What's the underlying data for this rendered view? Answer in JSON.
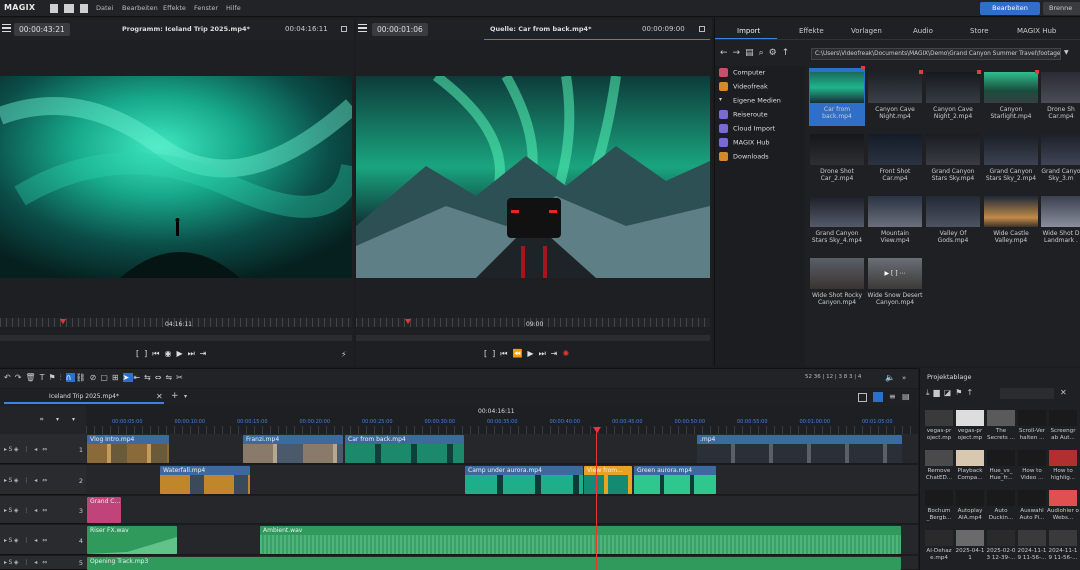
{
  "app": {
    "logo": "MAGIX",
    "menu": [
      "Datei",
      "Bearbeiten",
      "Effekte",
      "Fenster",
      "Hilfe"
    ],
    "mode_active": "Bearbeiten",
    "mode_other": "Brenne"
  },
  "program_monitor": {
    "timecode": "00:00:43:21",
    "title": "Programm: Iceland Trip 2025.mp4*",
    "duration": "00:04:16:11",
    "ruler_label": "04:16:11"
  },
  "source_monitor": {
    "timecode": "00:00:01:06",
    "title": "Quelle: Car from back.mp4*",
    "duration": "00:00:09:00",
    "ruler_label": "09:00"
  },
  "media_pool": {
    "tabs": [
      "Import",
      "Effekte",
      "Vorlagen",
      "Audio",
      "Store",
      "MAGIX Hub"
    ],
    "active_tab": "Import",
    "path": "C:\\Users\\Videofreak\\Documents\\MAGIX\\Demo\\Grand Canyon Summer Travel\\footage",
    "tree": [
      {
        "label": "Computer",
        "icon": "computer-icon",
        "color": "#c9506a"
      },
      {
        "label": "Videofreak",
        "icon": "user-icon",
        "color": "#d48a2c"
      },
      {
        "label": "Eigene Medien",
        "icon": "chevron-down-icon",
        "color": ""
      },
      {
        "label": "Reiseroute",
        "icon": "pin-icon",
        "color": "#7b6bd1"
      },
      {
        "label": "Cloud Import",
        "icon": "cloud-icon",
        "color": "#7b6bd1"
      },
      {
        "label": "MAGIX Hub",
        "icon": "hub-icon",
        "color": "#7b6bd1"
      },
      {
        "label": "Downloads",
        "icon": "download-icon",
        "color": "#d48a2c"
      }
    ],
    "files": [
      {
        "name": "Car from back.mp4",
        "selected": true
      },
      {
        "name": "Canyon Cave Night.mp4"
      },
      {
        "name": "Canyon Cave Night_2.mp4"
      },
      {
        "name": "Canyon Starlight.mp4"
      },
      {
        "name": "Drone Sh Car.mp4"
      },
      {
        "name": "Drone Shot Car_2.mp4"
      },
      {
        "name": "Front Shot Car.mp4"
      },
      {
        "name": "Grand Canyon Stars Sky.mp4"
      },
      {
        "name": "Grand Canyon Stars Sky_2.mp4"
      },
      {
        "name": "Grand Canyo Sky_3.m"
      },
      {
        "name": "Grand Canyon Stars Sky_4.mp4"
      },
      {
        "name": "Mountain View.mp4"
      },
      {
        "name": "Valley Of Gods.mp4"
      },
      {
        "name": "Wide Castle Valley.mp4"
      },
      {
        "name": "Wide Shot D Landmark ."
      },
      {
        "name": "Wide Shot Rocky Canyon.mp4"
      },
      {
        "name": "Wide Snow Desert Canyon.mp4"
      }
    ]
  },
  "timeline": {
    "tab": "Iceland Trip 2025.mp4*",
    "zoom_values": [
      "52",
      "36",
      "12",
      "3",
      "8",
      "3",
      "4"
    ],
    "current_time": "00:04:16:11",
    "ruler_ticks": [
      "00:00:05:00",
      "00:00:10:00",
      "00:00:15:00",
      "00:00:20:00",
      "00:00:25:00",
      "00:00:30:00",
      "00:00:35:00",
      "00:00:40:00",
      "00:00:45:00",
      "00:00:50:00",
      "00:00:55:00",
      "00:01:00:00",
      "00:01:05:00"
    ],
    "tracks": [
      {
        "num": "1"
      },
      {
        "num": "2"
      },
      {
        "num": "3"
      },
      {
        "num": "4"
      },
      {
        "num": "5"
      }
    ],
    "clips": {
      "t1": [
        "Vlog Intro.mp4",
        "Franzi.mp4",
        "Car from back.mp4",
        ".mp4"
      ],
      "t2": [
        "Waterfall.mp4",
        "Camp under aurora.mp4",
        "View from...",
        "Green aurora.mp4"
      ],
      "t3": [
        "Grand C..."
      ],
      "t4": [
        "Riser FX.wav",
        "Ambient.wav"
      ],
      "t5": [
        "Opening Track.mp3"
      ]
    }
  },
  "project": {
    "title": "Projektablage",
    "items": [
      "vegas-pr oject.mp",
      "vegas-pr oject.mp",
      "The Secrets ...",
      "Scroll-Ver halten ...",
      "Screengr ab Aut...",
      "Remove ChatED...",
      "Playback Compa...",
      "Hue_vs_ Hue_fr...",
      "How to Video ...",
      "How to highlig...",
      "Bochum _Bergb...",
      "Autoplay AIA.mp4",
      "Auto Duckin...",
      "Auswahl Auto Pi...",
      "Audiohier o Webs...",
      "AI-Dehaz e.mp4",
      "2025-04-1 1",
      "2025-02-0 3 12-39-...",
      "2024-11-1 9 11-56-...",
      "2024-11-1 9 11-56-..."
    ]
  }
}
